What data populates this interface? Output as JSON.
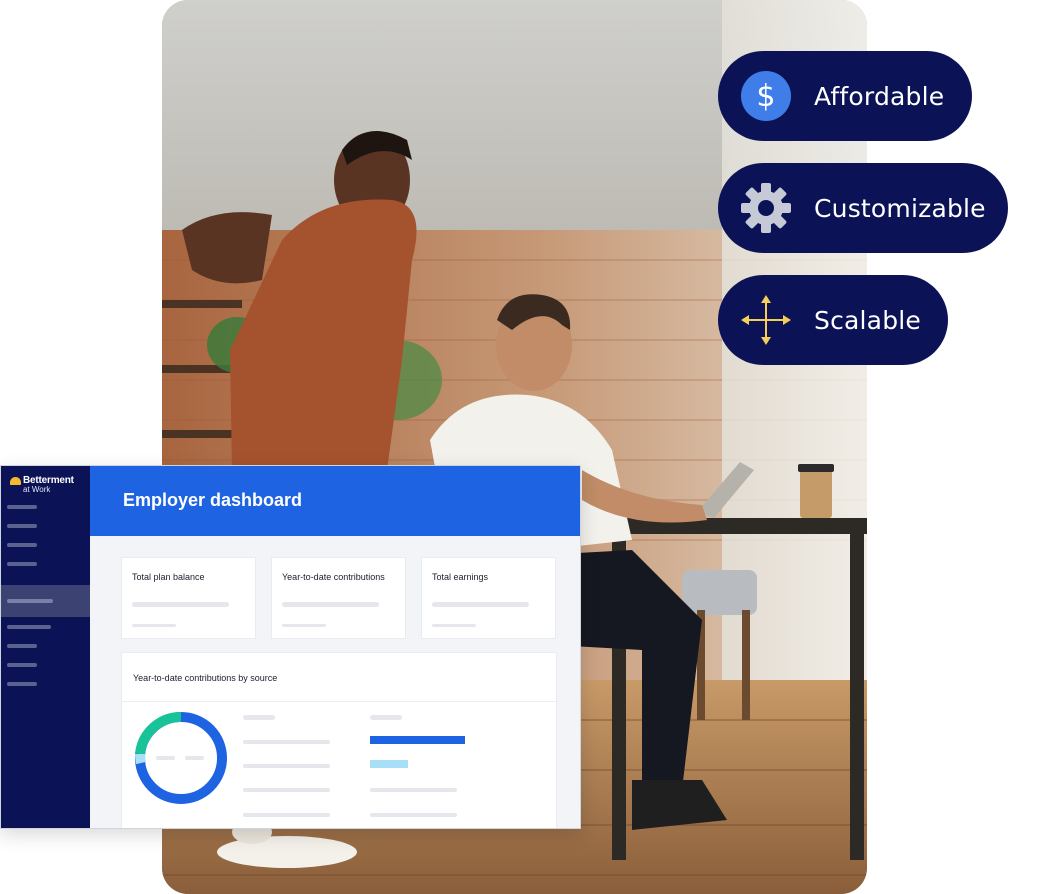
{
  "features": [
    {
      "label": "Affordable",
      "icon": "dollar-icon"
    },
    {
      "label": "Customizable",
      "icon": "gear-icon"
    },
    {
      "label": "Scalable",
      "icon": "move-arrows-icon"
    }
  ],
  "dashboard": {
    "brand": {
      "name": "Betterment",
      "sub": "at Work"
    },
    "title": "Employer dashboard",
    "cards": [
      {
        "label": "Total plan balance"
      },
      {
        "label": "Year-to-date contributions"
      },
      {
        "label": "Total earnings"
      }
    ],
    "panel": {
      "title": "Year-to-date contributions by source"
    }
  },
  "colors": {
    "navy": "#0b1356",
    "header_blue": "#1e63e2",
    "donut_blue": "#1e63e2",
    "donut_green": "#19c39a",
    "donut_light": "#a8dff6",
    "logo_yellow": "#f5b82e",
    "icon_blue": "#3f7ee8",
    "icon_gray": "#c6c9d6",
    "icon_yellow": "#f5cd59"
  }
}
